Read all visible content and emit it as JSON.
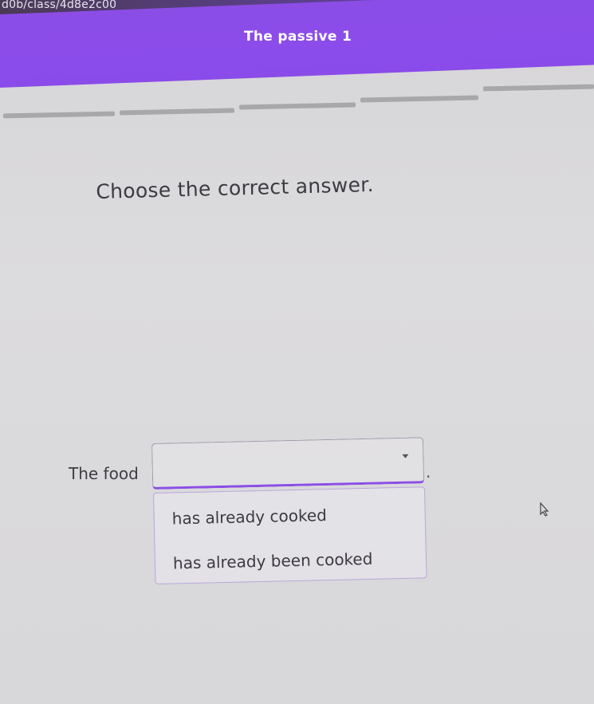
{
  "browser": {
    "url_fragment": "d0b/class/4d8e2c00"
  },
  "header": {
    "title": "The passive 1"
  },
  "progress": {
    "segments_total": 5
  },
  "question": {
    "instruction": "Choose the correct answer.",
    "sentence_start": "The food",
    "sentence_end": ".",
    "dropdown": {
      "selected": "",
      "options": [
        "has already cooked",
        "has already been cooked"
      ]
    }
  },
  "colors": {
    "accent": "#8b4de6",
    "text": "#3d3b41"
  }
}
